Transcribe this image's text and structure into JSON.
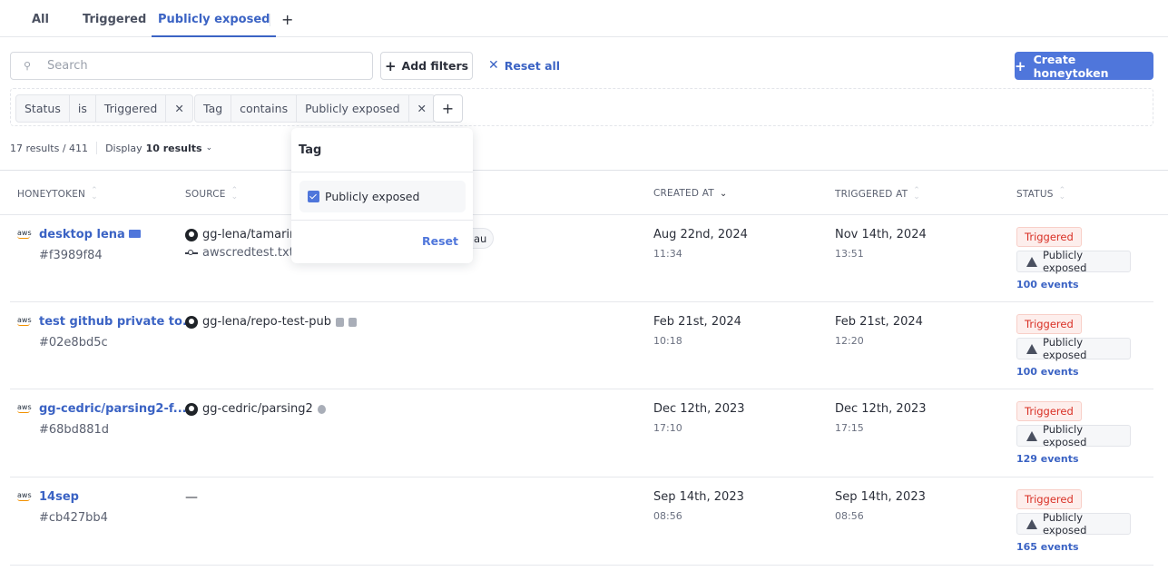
{
  "tabs": [
    {
      "label": "All",
      "active": false
    },
    {
      "label": "Triggered",
      "active": false
    },
    {
      "label": "Publicly exposed",
      "active": true
    }
  ],
  "tab_add_label": "+",
  "toolbar": {
    "search_placeholder": "Search",
    "search_value": "",
    "add_filters_label": "Add filters",
    "reset_all_label": "Reset all",
    "create_label": "Create honeytoken"
  },
  "filters": [
    {
      "field": "Status",
      "operator": "is",
      "value": "Triggered"
    },
    {
      "field": "Tag",
      "operator": "contains",
      "value": "Publicly exposed"
    }
  ],
  "results": {
    "count": "17 results",
    "total": "/ 411",
    "display_prefix": "Display",
    "display_value": "10 results"
  },
  "columns": {
    "honeytoken": "HONEYTOKEN",
    "source": "SOURCE",
    "created_at": "CREATED AT",
    "triggered_at": "TRIGGERED AT",
    "status": "STATUS"
  },
  "rows": [
    {
      "provider": "aws",
      "name": "desktop lena",
      "id": "#f3989f84",
      "source": "gg-lena/tamarin",
      "source_file": "awscredtest.txt",
      "tag_partial": "au",
      "created_date": "Aug 22nd, 2024",
      "created_time": "11:34",
      "triggered_date": "Nov 14th, 2024",
      "triggered_time": "13:51",
      "status": "Triggered",
      "tag": "Publicly exposed",
      "events": "100 events"
    },
    {
      "provider": "aws",
      "name": "test github private to...",
      "id": "#02e8bd5c",
      "source": "gg-lena/repo-test-pub",
      "created_date": "Feb 21st, 2024",
      "created_time": "10:18",
      "triggered_date": "Feb 21st, 2024",
      "triggered_time": "12:20",
      "status": "Triggered",
      "tag": "Publicly exposed",
      "events": "100 events"
    },
    {
      "provider": "aws",
      "name": "gg-cedric/parsing2-f...",
      "id": "#68bd881d",
      "source": "gg-cedric/parsing2",
      "created_date": "Dec 12th, 2023",
      "created_time": "17:10",
      "triggered_date": "Dec 12th, 2023",
      "triggered_time": "17:15",
      "status": "Triggered",
      "tag": "Publicly exposed",
      "events": "129 events"
    },
    {
      "provider": "aws",
      "name": "14sep",
      "id": "#cb427bb4",
      "source": "—",
      "created_date": "Sep 14th, 2023",
      "created_time": "08:56",
      "triggered_date": "Sep 14th, 2023",
      "triggered_time": "08:56",
      "status": "Triggered",
      "tag": "Publicly exposed",
      "events": "165 events"
    }
  ],
  "popover": {
    "title": "Tag",
    "option_label": "Publicly exposed",
    "option_checked": true,
    "reset_label": "Reset"
  },
  "colors": {
    "accent": "#4f76db",
    "link": "#3b63c4",
    "triggered": "#d93025"
  }
}
